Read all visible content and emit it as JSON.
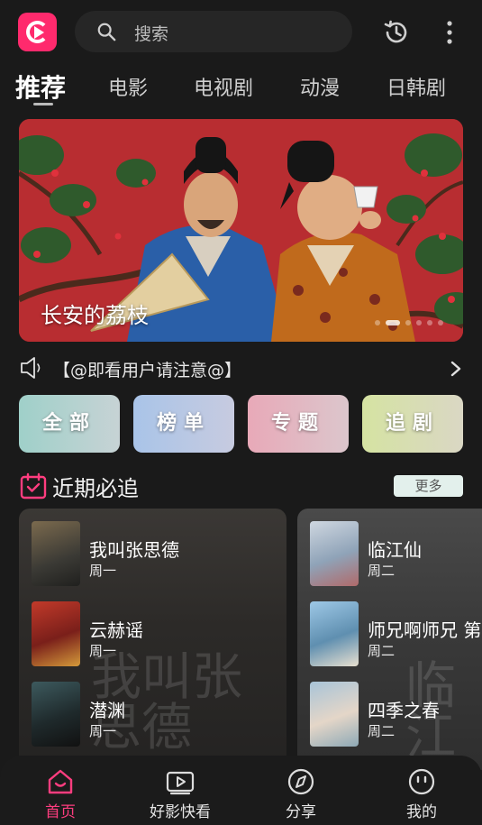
{
  "search": {
    "placeholder": "搜索"
  },
  "tabs": [
    {
      "label": "推荐",
      "active": true
    },
    {
      "label": "电影"
    },
    {
      "label": "电视剧"
    },
    {
      "label": "动漫"
    },
    {
      "label": "日韩剧"
    }
  ],
  "banner": {
    "title": "长安的荔枝",
    "slide_count": 6,
    "active_slide": 1
  },
  "notice": {
    "text": "【@即看用户请注意@】"
  },
  "quick_buttons": [
    {
      "label": "全部",
      "color": "#9fd0c9"
    },
    {
      "label": "榜单",
      "color": "#a9c4e8"
    },
    {
      "label": "专题",
      "color": "#e8a9b8"
    },
    {
      "label": "追剧",
      "color": "#d5e3a2"
    }
  ],
  "section": {
    "title": "近期必追",
    "more_label": "更多"
  },
  "cards": [
    {
      "watermark": "我叫张思德",
      "items": [
        {
          "name": "我叫张思德",
          "day": "周一"
        },
        {
          "name": "云赫谣",
          "day": "周一"
        },
        {
          "name": "潜渊",
          "day": "周一"
        }
      ]
    },
    {
      "watermark": "临江仙",
      "items": [
        {
          "name": "临江仙",
          "day": "周二"
        },
        {
          "name": "师兄啊师兄 第",
          "day": "周二"
        },
        {
          "name": "四季之春",
          "day": "周二"
        }
      ]
    }
  ],
  "nav": [
    {
      "label": "首页",
      "active": true
    },
    {
      "label": "好影快看"
    },
    {
      "label": "分享"
    },
    {
      "label": "我的"
    }
  ],
  "colors": {
    "accent": "#ff3d7f",
    "background": "#1a1a1a"
  }
}
